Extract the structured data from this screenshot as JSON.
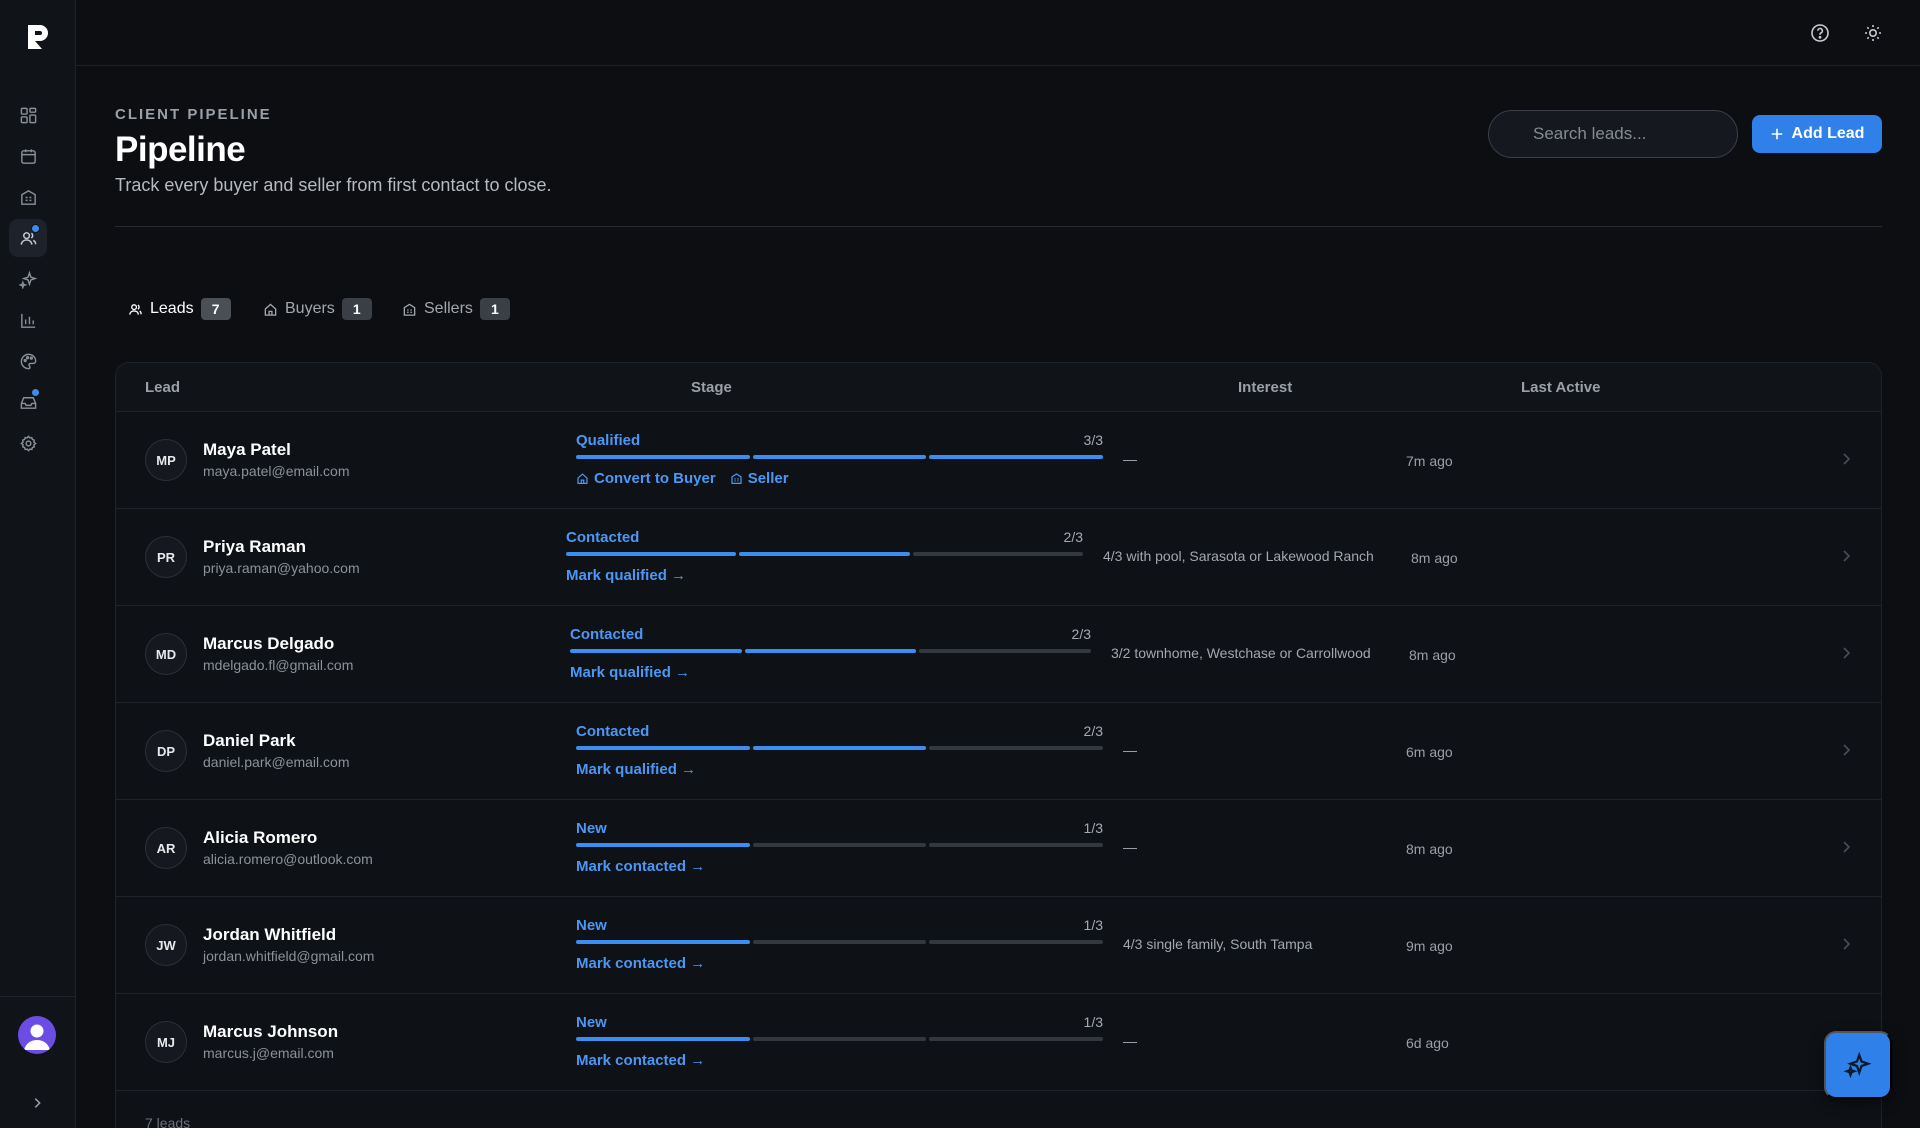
{
  "app": {
    "logo_icon": "brand-p-logo"
  },
  "sidebar": {
    "items": [
      {
        "icon": "dashboard-grid-icon",
        "active": false,
        "badge": false
      },
      {
        "icon": "calendar-icon",
        "active": false,
        "badge": false
      },
      {
        "icon": "building-icon",
        "active": false,
        "badge": false
      },
      {
        "icon": "users-icon",
        "active": true,
        "badge": true
      },
      {
        "icon": "sparkles-icon",
        "active": false,
        "badge": false
      },
      {
        "icon": "bar-chart-icon",
        "active": false,
        "badge": false
      },
      {
        "icon": "palette-icon",
        "active": false,
        "badge": false
      },
      {
        "icon": "inbox-icon",
        "active": false,
        "badge": true
      },
      {
        "icon": "settings-gear-icon",
        "active": false,
        "badge": false
      }
    ]
  },
  "topbar": {
    "help_icon": "help-circle-icon",
    "theme_icon": "sun-icon"
  },
  "header": {
    "eyebrow": "CLIENT PIPELINE",
    "title": "Pipeline",
    "subtitle": "Track every buyer and seller from first contact to close."
  },
  "search": {
    "placeholder": "Search leads..."
  },
  "add_button": {
    "label": "Add Lead"
  },
  "tabs": [
    {
      "label": "Leads",
      "count": "7",
      "active": true
    },
    {
      "label": "Buyers",
      "count": "1",
      "active": false
    },
    {
      "label": "Sellers",
      "count": "1",
      "active": false
    }
  ],
  "table": {
    "columns": [
      "Lead",
      "Stage",
      "Interest",
      "Last Active"
    ],
    "rows": [
      {
        "initials": "MP",
        "name": "Maya Patel",
        "email": "maya.patel@email.com",
        "stage": "Qualified",
        "progress": "3/3",
        "filled": 3,
        "actions": [
          "Convert to Buyer",
          "Seller"
        ],
        "interest": "—",
        "last_active": "7m ago"
      },
      {
        "initials": "PR",
        "name": "Priya Raman",
        "email": "priya.raman@yahoo.com",
        "stage": "Contacted",
        "progress": "2/3",
        "filled": 2,
        "actions": [
          "Mark qualified →"
        ],
        "interest": "4/3 with pool, Sarasota or Lakewood Ranch",
        "last_active": "8m ago"
      },
      {
        "initials": "MD",
        "name": "Marcus Delgado",
        "email": "mdelgado.fl@gmail.com",
        "stage": "Contacted",
        "progress": "2/3",
        "filled": 2,
        "actions": [
          "Mark qualified →"
        ],
        "interest": "3/2 townhome, Westchase or Carrollwood",
        "last_active": "8m ago"
      },
      {
        "initials": "DP",
        "name": "Daniel Park",
        "email": "daniel.park@email.com",
        "stage": "Contacted",
        "progress": "2/3",
        "filled": 2,
        "actions": [
          "Mark qualified →"
        ],
        "interest": "—",
        "last_active": "6m ago"
      },
      {
        "initials": "AR",
        "name": "Alicia Romero",
        "email": "alicia.romero@outlook.com",
        "stage": "New",
        "progress": "1/3",
        "filled": 1,
        "actions": [
          "Mark contacted →"
        ],
        "interest": "—",
        "last_active": "8m ago"
      },
      {
        "initials": "JW",
        "name": "Jordan Whitfield",
        "email": "jordan.whitfield@gmail.com",
        "stage": "New",
        "progress": "1/3",
        "filled": 1,
        "actions": [
          "Mark contacted →"
        ],
        "interest": "4/3 single family, South Tampa",
        "last_active": "9m ago"
      },
      {
        "initials": "MJ",
        "name": "Marcus Johnson",
        "email": "marcus.j@email.com",
        "stage": "New",
        "progress": "1/3",
        "filled": 1,
        "actions": [
          "Mark contacted →"
        ],
        "interest": "—",
        "last_active": "6d ago"
      }
    ],
    "footer": "7 leads"
  },
  "fab": {
    "icon": "sparkles-icon"
  },
  "colors": {
    "accent": "#2f80e8",
    "background": "#0c0e12",
    "stage_blue": "#4b97f4"
  }
}
